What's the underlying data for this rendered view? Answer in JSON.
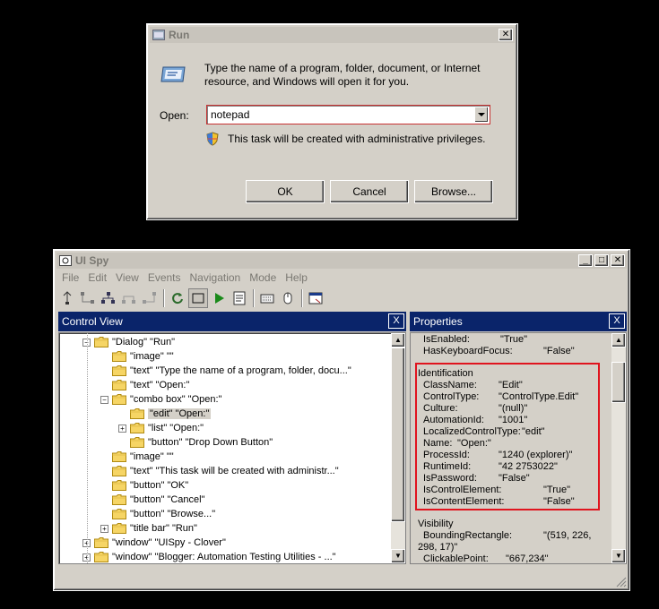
{
  "run": {
    "title": "Run",
    "description_line1": "Type the name of a program, folder, document, or Internet",
    "description_line2": "resource, and Windows will open it for you.",
    "open_label": "Open:",
    "open_value": "notepad",
    "admin_note": "This task will be created with administrative privileges.",
    "ok_label": "OK",
    "cancel_label": "Cancel",
    "browse_label": "Browse..."
  },
  "uispy": {
    "title": "UI Spy",
    "menu": [
      "File",
      "Edit",
      "View",
      "Events",
      "Navigation",
      "Mode",
      "Help"
    ],
    "control_view_title": "Control View",
    "properties_title": "Properties",
    "tree": [
      {
        "depth": 0,
        "toggle": "−",
        "text": "\"Dialog\" \"Run\"",
        "selected": false
      },
      {
        "depth": 1,
        "toggle": "",
        "text": "\"image\" \"\"",
        "selected": false
      },
      {
        "depth": 1,
        "toggle": "",
        "text": "\"text\" \"Type the name of a program, folder, docu...\"",
        "selected": false
      },
      {
        "depth": 1,
        "toggle": "",
        "text": "\"text\" \"Open:\"",
        "selected": false
      },
      {
        "depth": 1,
        "toggle": "−",
        "text": "\"combo box\" \"Open:\"",
        "selected": false
      },
      {
        "depth": 2,
        "toggle": "",
        "text": "\"edit\" \"Open:\"",
        "selected": true
      },
      {
        "depth": 2,
        "toggle": "+",
        "text": "\"list\" \"Open:\"",
        "selected": false
      },
      {
        "depth": 2,
        "toggle": "",
        "text": "\"button\" \"Drop Down Button\"",
        "selected": false
      },
      {
        "depth": 1,
        "toggle": "",
        "text": "\"image\" \"\"",
        "selected": false
      },
      {
        "depth": 1,
        "toggle": "",
        "text": "\"text\" \"This task will be created with administr...\"",
        "selected": false
      },
      {
        "depth": 1,
        "toggle": "",
        "text": "\"button\" \"OK\"",
        "selected": false
      },
      {
        "depth": 1,
        "toggle": "",
        "text": "\"button\" \"Cancel\"",
        "selected": false
      },
      {
        "depth": 1,
        "toggle": "",
        "text": "\"button\" \"Browse...\"",
        "selected": false
      },
      {
        "depth": 1,
        "toggle": "+",
        "text": "\"title bar\" \"Run\"",
        "selected": false
      },
      {
        "depth": -1,
        "toggle": "+",
        "text": "\"window\" \"UISpy - Clover\"",
        "selected": false
      },
      {
        "depth": -1,
        "toggle": "+",
        "text": "\"window\" \"Blogger: Automation Testing Utilities - ...\"",
        "selected": false
      }
    ],
    "properties": {
      "top": [
        {
          "name": "IsEnabled:",
          "value": "\"True\""
        },
        {
          "name": "HasKeyboardFocus:",
          "value": "\"False\""
        }
      ],
      "identification_header": "Identification",
      "identification": [
        {
          "name": "ClassName:",
          "value": "\"Edit\""
        },
        {
          "name": "ControlType:",
          "value": "\"ControlType.Edit\""
        },
        {
          "name": "Culture:",
          "value": "\"(null)\""
        },
        {
          "name": "AutomationId:",
          "value": "\"1001\""
        },
        {
          "name": "LocalizedControlType:",
          "value": "\"edit\""
        },
        {
          "name": "Name:",
          "value": "\"Open:\""
        },
        {
          "name": "ProcessId:",
          "value": "\"1240 (explorer)\""
        },
        {
          "name": "RuntimeId:",
          "value": "\"42 2753022\""
        },
        {
          "name": "IsPassword:",
          "value": "\"False\""
        },
        {
          "name": "IsControlElement:",
          "value": "\"True\""
        },
        {
          "name": "IsContentElement:",
          "value": "\"False\""
        }
      ],
      "visibility_header": "Visibility",
      "visibility": [
        {
          "name": "BoundingRectangle:",
          "value": "\"(519, 226,",
          "value2": "298, 17)\""
        },
        {
          "name": "ClickablePoint:",
          "value": "\"667,234\""
        }
      ]
    },
    "highlight_color": "#e0141e",
    "accent_color": "#0a246a"
  }
}
